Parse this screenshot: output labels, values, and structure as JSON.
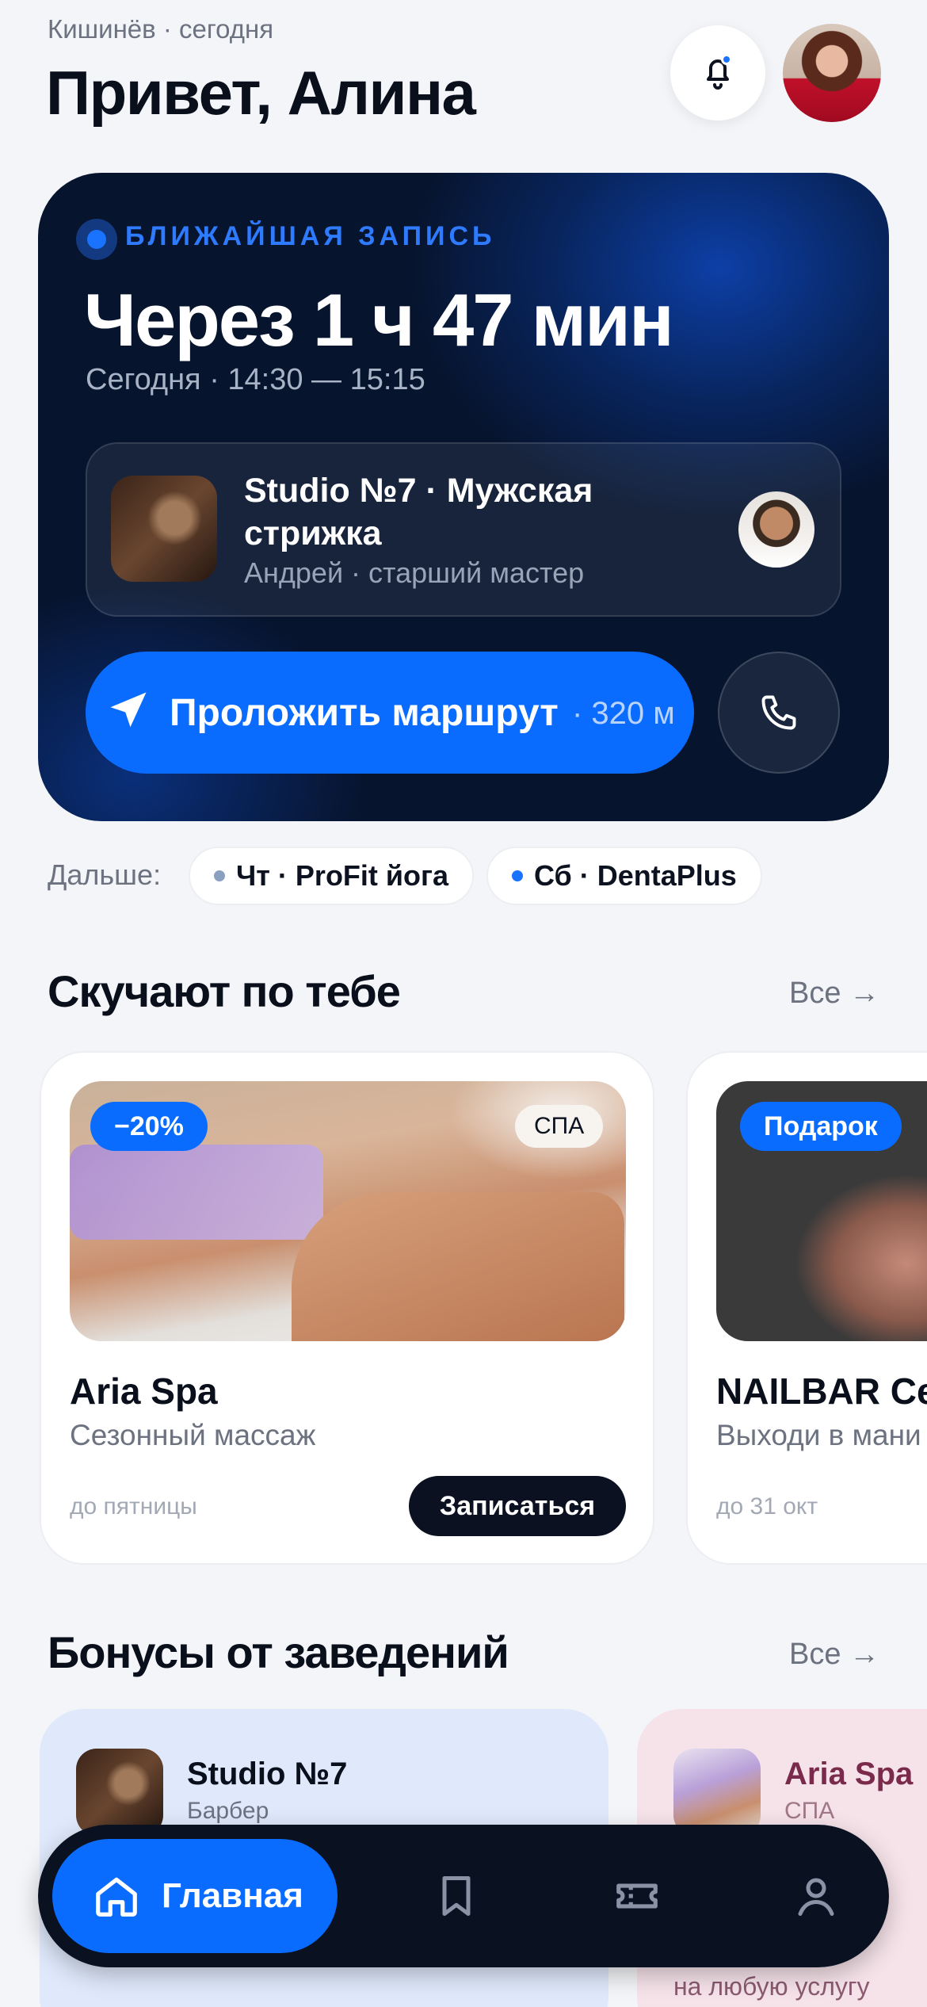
{
  "header": {
    "location": "Кишинёв · сегодня",
    "greeting": "Привет, Алина",
    "icons": {
      "bell": "bell-icon",
      "avatar": "user-avatar"
    }
  },
  "hero": {
    "kicker": "БЛИЖАЙШАЯ ЗАПИСЬ",
    "countdown": "Через 1 ч 47 мин",
    "when": "Сегодня · 14:30 — 15:15",
    "appointment": {
      "title": "Studio №7 · Мужская стрижка",
      "master": "Андрей · старший мастер"
    },
    "route_label": "Проложить маршрут",
    "route_distance": "· 320 м",
    "icons": {
      "route": "navigation-arrow-icon",
      "call": "phone-icon"
    }
  },
  "next": {
    "label": "Дальше:",
    "items": [
      {
        "label": "Чт · ProFit йога",
        "dot_color": "#8aa0c0"
      },
      {
        "label": "Сб · DentaPlus",
        "dot_color": "#1a73ff"
      }
    ]
  },
  "offers_section": {
    "title": "Скучают по тебе",
    "all_label": "Все →",
    "cards": [
      {
        "badge": "−20%",
        "tag": "СПА",
        "name": "Aria Spa",
        "desc": "Сезонный массаж",
        "until": "до пятницы",
        "cta": "Записаться"
      },
      {
        "badge": "Подарок",
        "name": "NAILBAR Cen",
        "desc": "Выходи в мани",
        "until": "до 31 окт"
      }
    ]
  },
  "bonus_section": {
    "title": "Бонусы от заведений",
    "all_label": "Все →",
    "cards": [
      {
        "name": "Studio №7",
        "type": "Барбер"
      },
      {
        "name": "Aria Spa",
        "type": "СПА",
        "footer": "на любую услугу"
      }
    ]
  },
  "tabbar": {
    "home_label": "Главная",
    "icons": [
      "home-icon",
      "bookmark-icon",
      "ticket-icon",
      "profile-icon"
    ]
  },
  "colors": {
    "accent": "#0a6cff",
    "dark": "#0a1120",
    "bonus_blue": "#dfe9fb",
    "bonus_pink": "#f6e3ea"
  }
}
